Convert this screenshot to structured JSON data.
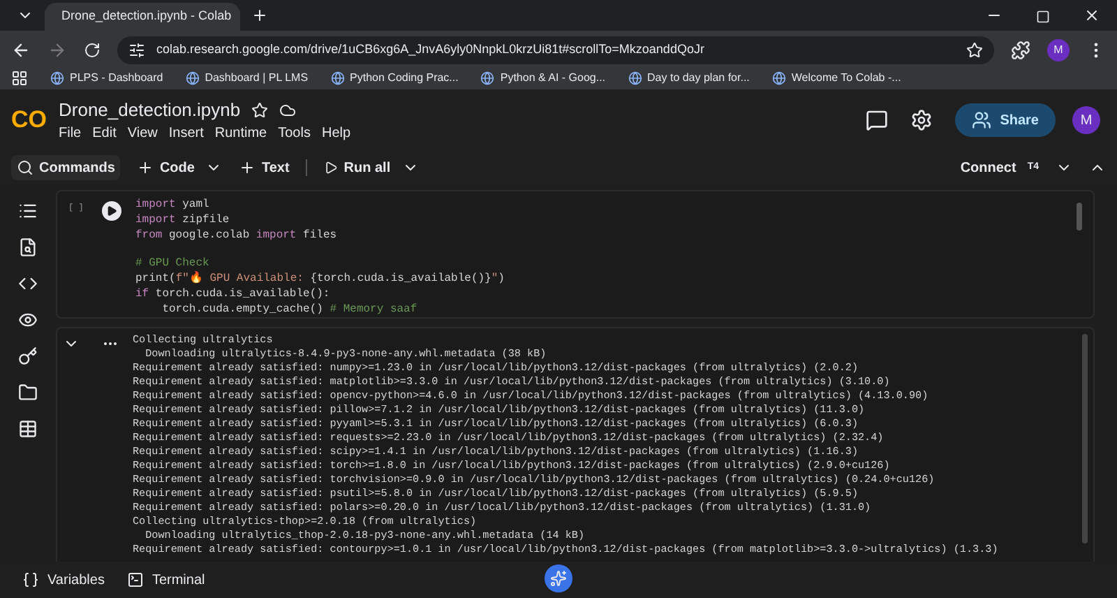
{
  "browser": {
    "tab_title": "Drone_detection.ipynb - Colab",
    "url": "colab.research.google.com/drive/1uCB6xg6A_JnvA6yly0NnpkL0krzUi81t#scrollTo=MkzoanddQoJr",
    "profile": "M",
    "bookmarks": [
      "PLPS - Dashboard",
      "Dashboard | PL LMS",
      "Python Coding Prac...",
      "Python & AI - Goog...",
      "Day to day plan for...",
      "Welcome To Colab -..."
    ]
  },
  "notebook": {
    "logo": "CO",
    "title": "Drone_detection.ipynb",
    "menu": [
      "File",
      "Edit",
      "View",
      "Insert",
      "Runtime",
      "Tools",
      "Help"
    ],
    "share": "Share",
    "avatar": "M"
  },
  "toolbar": {
    "commands": "Commands",
    "add_code": "Code",
    "add_text": "Text",
    "run_all": "Run all",
    "connect": "Connect",
    "runtime": "T4"
  },
  "cell": {
    "exec_count": "[ ]",
    "code": [
      {
        "kind": "code",
        "tokens": [
          {
            "kind": "keyword",
            "text": "import"
          },
          {
            "kind": "plain",
            "text": " yaml"
          }
        ]
      },
      {
        "kind": "code",
        "tokens": [
          {
            "kind": "keyword",
            "text": "import"
          },
          {
            "kind": "plain",
            "text": " zipfile"
          }
        ]
      },
      {
        "kind": "code",
        "tokens": [
          {
            "kind": "keyword",
            "text": "from"
          },
          {
            "kind": "plain",
            "text": " google.colab "
          },
          {
            "kind": "keyword",
            "text": "import"
          },
          {
            "kind": "plain",
            "text": " files"
          }
        ]
      },
      {
        "kind": "blank"
      },
      {
        "kind": "code",
        "tokens": [
          {
            "kind": "comment",
            "text": "# GPU Check"
          }
        ]
      },
      {
        "kind": "code",
        "tokens": [
          {
            "kind": "plain",
            "text": "print("
          },
          {
            "kind": "string",
            "text": "f\"🔥 GPU Available: "
          },
          {
            "kind": "plain",
            "text": "{torch.cuda.is_available()}"
          },
          {
            "kind": "string",
            "text": "\""
          },
          {
            "kind": "plain",
            "text": ")"
          }
        ]
      },
      {
        "kind": "code",
        "tokens": [
          {
            "kind": "keyword",
            "text": "if"
          },
          {
            "kind": "plain",
            "text": " torch.cuda.is_available():"
          }
        ]
      },
      {
        "kind": "code",
        "tokens": [
          {
            "kind": "plain",
            "text": "    torch.cuda.empty_cache() "
          },
          {
            "kind": "comment",
            "text": "# Memory saaf"
          }
        ]
      }
    ],
    "output": [
      "Collecting ultralytics",
      "  Downloading ultralytics-8.4.9-py3-none-any.whl.metadata (38 kB)",
      "Requirement already satisfied: numpy>=1.23.0 in /usr/local/lib/python3.12/dist-packages (from ultralytics) (2.0.2)",
      "Requirement already satisfied: matplotlib>=3.3.0 in /usr/local/lib/python3.12/dist-packages (from ultralytics) (3.10.0)",
      "Requirement already satisfied: opencv-python>=4.6.0 in /usr/local/lib/python3.12/dist-packages (from ultralytics) (4.13.0.90)",
      "Requirement already satisfied: pillow>=7.1.2 in /usr/local/lib/python3.12/dist-packages (from ultralytics) (11.3.0)",
      "Requirement already satisfied: pyyaml>=5.3.1 in /usr/local/lib/python3.12/dist-packages (from ultralytics) (6.0.3)",
      "Requirement already satisfied: requests>=2.23.0 in /usr/local/lib/python3.12/dist-packages (from ultralytics) (2.32.4)",
      "Requirement already satisfied: scipy>=1.4.1 in /usr/local/lib/python3.12/dist-packages (from ultralytics) (1.16.3)",
      "Requirement already satisfied: torch>=1.8.0 in /usr/local/lib/python3.12/dist-packages (from ultralytics) (2.9.0+cu126)",
      "Requirement already satisfied: torchvision>=0.9.0 in /usr/local/lib/python3.12/dist-packages (from ultralytics) (0.24.0+cu126)",
      "Requirement already satisfied: psutil>=5.8.0 in /usr/local/lib/python3.12/dist-packages (from ultralytics) (5.9.5)",
      "Requirement already satisfied: polars>=0.20.0 in /usr/local/lib/python3.12/dist-packages (from ultralytics) (1.31.0)",
      "Collecting ultralytics-thop>=2.0.18 (from ultralytics)",
      "  Downloading ultralytics_thop-2.0.18-py3-none-any.whl.metadata (14 kB)",
      "Requirement already satisfied: contourpy>=1.0.1 in /usr/local/lib/python3.12/dist-packages (from matplotlib>=3.3.0->ultralytics) (1.3.3)"
    ]
  },
  "bottom_bar": [
    "Variables",
    "Terminal"
  ]
}
